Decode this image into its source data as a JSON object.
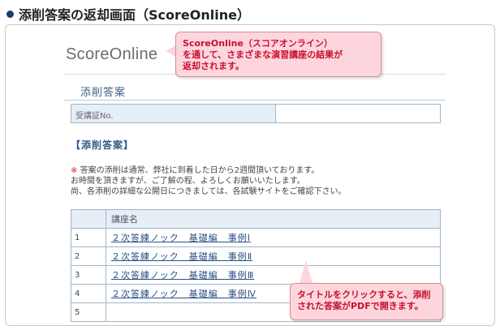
{
  "page_heading": "添削答案の返却画面（ScoreOnline）",
  "logo": "ScoreOnline",
  "section_title": "添削答案",
  "id_label": "受講証No.",
  "bracket_title": "【添削答案】",
  "notice": {
    "mark": "※",
    "line1": "答案の添削は通常、弊社に到着した日から2週間頂いております。",
    "line2": "お時間を頂きますが、ご了解の程、よろしくお願いいたします。",
    "line3": "尚、各添削の詳細な公開日につきましては、各試験サイトをご確認下さい。"
  },
  "table": {
    "header": "講座名",
    "rows": [
      {
        "num": "1",
        "title": "２次答練ノック　基礎編　事例Ⅰ"
      },
      {
        "num": "2",
        "title": "２次答練ノック　基礎編　事例Ⅱ"
      },
      {
        "num": "3",
        "title": "２次答練ノック　基礎編　事例Ⅲ"
      },
      {
        "num": "4",
        "title": "２次答練ノック　基礎編　事例Ⅳ"
      },
      {
        "num": "5",
        "title": ""
      }
    ]
  },
  "callout_logo": {
    "line1": "ScoreOnline（スコアオンライン）",
    "line2": "を通して、さまざまな演習講座の結果が",
    "line3": "返却されます。"
  },
  "callout_title": {
    "line1": "タイトルをクリックすると、添削",
    "line2": "された答案がPDFで開きます。"
  },
  "colors": {
    "callout_bg": "#fdd6dd",
    "callout_text": "#c8102e",
    "link": "#2a4f84",
    "header_bg": "#e6eef6"
  }
}
